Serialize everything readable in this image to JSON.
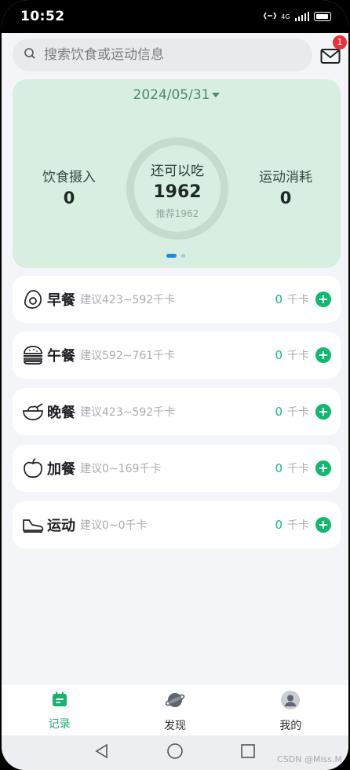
{
  "status": {
    "time": "10:52",
    "network": "4G"
  },
  "search": {
    "placeholder": "搜索饮食或运动信息"
  },
  "messages": {
    "badge": "1"
  },
  "summary": {
    "date": "2024/05/31",
    "intake_label": "饮食摄入",
    "intake_value": "0",
    "remaining_label": "还可以吃",
    "remaining_value": "1962",
    "recommend_text": "推荐1962",
    "burn_label": "运动消耗",
    "burn_value": "0"
  },
  "meals": [
    {
      "name": "早餐",
      "suggest": "建议423~592千卡",
      "kcal": "0",
      "unit": "千卡",
      "icon": "egg-icon"
    },
    {
      "name": "午餐",
      "suggest": "建议592~761千卡",
      "kcal": "0",
      "unit": "千卡",
      "icon": "burger-icon"
    },
    {
      "name": "晚餐",
      "suggest": "建议423~592千卡",
      "kcal": "0",
      "unit": "千卡",
      "icon": "bowl-icon"
    },
    {
      "name": "加餐",
      "suggest": "建议0~169千卡",
      "kcal": "0",
      "unit": "千卡",
      "icon": "apple-icon"
    },
    {
      "name": "运动",
      "suggest": "建议0~0千卡",
      "kcal": "0",
      "unit": "千卡",
      "icon": "sneaker-icon"
    }
  ],
  "tabs": [
    {
      "label": "记录",
      "icon": "record-icon",
      "active": true
    },
    {
      "label": "发现",
      "icon": "planet-icon",
      "active": false
    },
    {
      "label": "我的",
      "icon": "user-icon",
      "active": false
    }
  ],
  "watermark": "CSDN @Miss.M",
  "colors": {
    "accent": "#10b96e",
    "summary_bg": "#d7eee1",
    "badge": "#e8323b"
  }
}
